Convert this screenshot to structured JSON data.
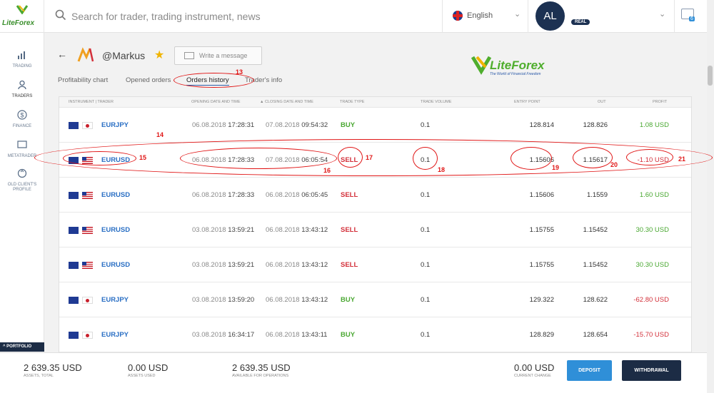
{
  "header": {
    "logo_text": "LiteForex",
    "search_placeholder": "Search for trader, trading instrument, news",
    "language": "English",
    "avatar_initials": "AL",
    "account_badge": "REAL",
    "messages_count": "6"
  },
  "sidebar": {
    "items": [
      {
        "label": "TRADING",
        "icon": "chart-icon"
      },
      {
        "label": "TRADERS",
        "icon": "user-icon"
      },
      {
        "label": "FINANCE",
        "icon": "dollar-icon"
      },
      {
        "label": "METATRADER",
        "icon": "monitor-icon"
      },
      {
        "label": "OLD CLIENT'S PROFILE",
        "icon": "refresh-icon"
      }
    ],
    "portfolio_label": "PORTFOLIO"
  },
  "profile": {
    "name": "@Markus",
    "write_message": "Write a message",
    "brand_text": "LiteForex",
    "brand_sub": "The World of Financial Freedom"
  },
  "tabs": [
    "Profitability chart",
    "Opened orders",
    "Orders history",
    "Trader's info"
  ],
  "table": {
    "headers": {
      "instrument": "INSTRUMENT | TRADER",
      "open": "OPENING DATE AND TIME",
      "close": "CLOSING DATE AND TIME",
      "type": "TRADE TYPE",
      "volume": "TRADE VOLUME",
      "entry": "ENTRY POINT",
      "out": "OUT",
      "profit": "PROFIT"
    },
    "rows": [
      {
        "symbol": "EURJPY",
        "open_date": "06.08.2018",
        "open_time": "17:28:31",
        "close_date": "07.08.2018",
        "close_time": "09:54:32",
        "type": "BUY",
        "volume": "0.1",
        "entry": "128.814",
        "out": "128.826",
        "profit": "1.08 USD"
      },
      {
        "symbol": "EURUSD",
        "open_date": "06.08.2018",
        "open_time": "17:28:33",
        "close_date": "07.08.2018",
        "close_time": "06:05:54",
        "type": "SELL",
        "volume": "0.1",
        "entry": "1.15606",
        "out": "1.15617",
        "profit": "-1.10 USD"
      },
      {
        "symbol": "EURUSD",
        "open_date": "06.08.2018",
        "open_time": "17:28:33",
        "close_date": "06.08.2018",
        "close_time": "06:05:45",
        "type": "SELL",
        "volume": "0.1",
        "entry": "1.15606",
        "out": "1.1559",
        "profit": "1.60 USD"
      },
      {
        "symbol": "EURUSD",
        "open_date": "03.08.2018",
        "open_time": "13:59:21",
        "close_date": "06.08.2018",
        "close_time": "13:43:12",
        "type": "SELL",
        "volume": "0.1",
        "entry": "1.15755",
        "out": "1.15452",
        "profit": "30.30 USD"
      },
      {
        "symbol": "EURUSD",
        "open_date": "03.08.2018",
        "open_time": "13:59:21",
        "close_date": "06.08.2018",
        "close_time": "13:43:12",
        "type": "SELL",
        "volume": "0.1",
        "entry": "1.15755",
        "out": "1.15452",
        "profit": "30.30 USD"
      },
      {
        "symbol": "EURJPY",
        "open_date": "03.08.2018",
        "open_time": "13:59:20",
        "close_date": "06.08.2018",
        "close_time": "13:43:12",
        "type": "BUY",
        "volume": "0.1",
        "entry": "129.322",
        "out": "128.622",
        "profit": "-62.80 USD"
      },
      {
        "symbol": "EURJPY",
        "open_date": "03.08.2018",
        "open_time": "16:34:17",
        "close_date": "06.08.2018",
        "close_time": "13:43:11",
        "type": "BUY",
        "volume": "0.1",
        "entry": "128.829",
        "out": "128.654",
        "profit": "-15.70 USD"
      }
    ]
  },
  "annotations": [
    "13",
    "14",
    "15",
    "16",
    "17",
    "18",
    "19",
    "20",
    "21"
  ],
  "footer": {
    "assets_total": "2 639.35 USD",
    "assets_total_label": "ASSETS, TOTAL",
    "assets_used": "0.00 USD",
    "assets_used_label": "ASSETS USED",
    "available": "2 639.35 USD",
    "available_label": "AVAILABLE FOR OPERATIONS",
    "current_change": "0.00 USD",
    "current_change_label": "CURRENT CHANGE",
    "deposit": "DEPOSIT",
    "withdrawal": "WITHDRAWAL"
  },
  "colors": {
    "accent": "#2a6fc4",
    "buy": "#4aa832",
    "sell": "#d3303a",
    "annotation": "#e01515",
    "deposit": "#2f8fd8",
    "withdrawal": "#1c2c45"
  }
}
